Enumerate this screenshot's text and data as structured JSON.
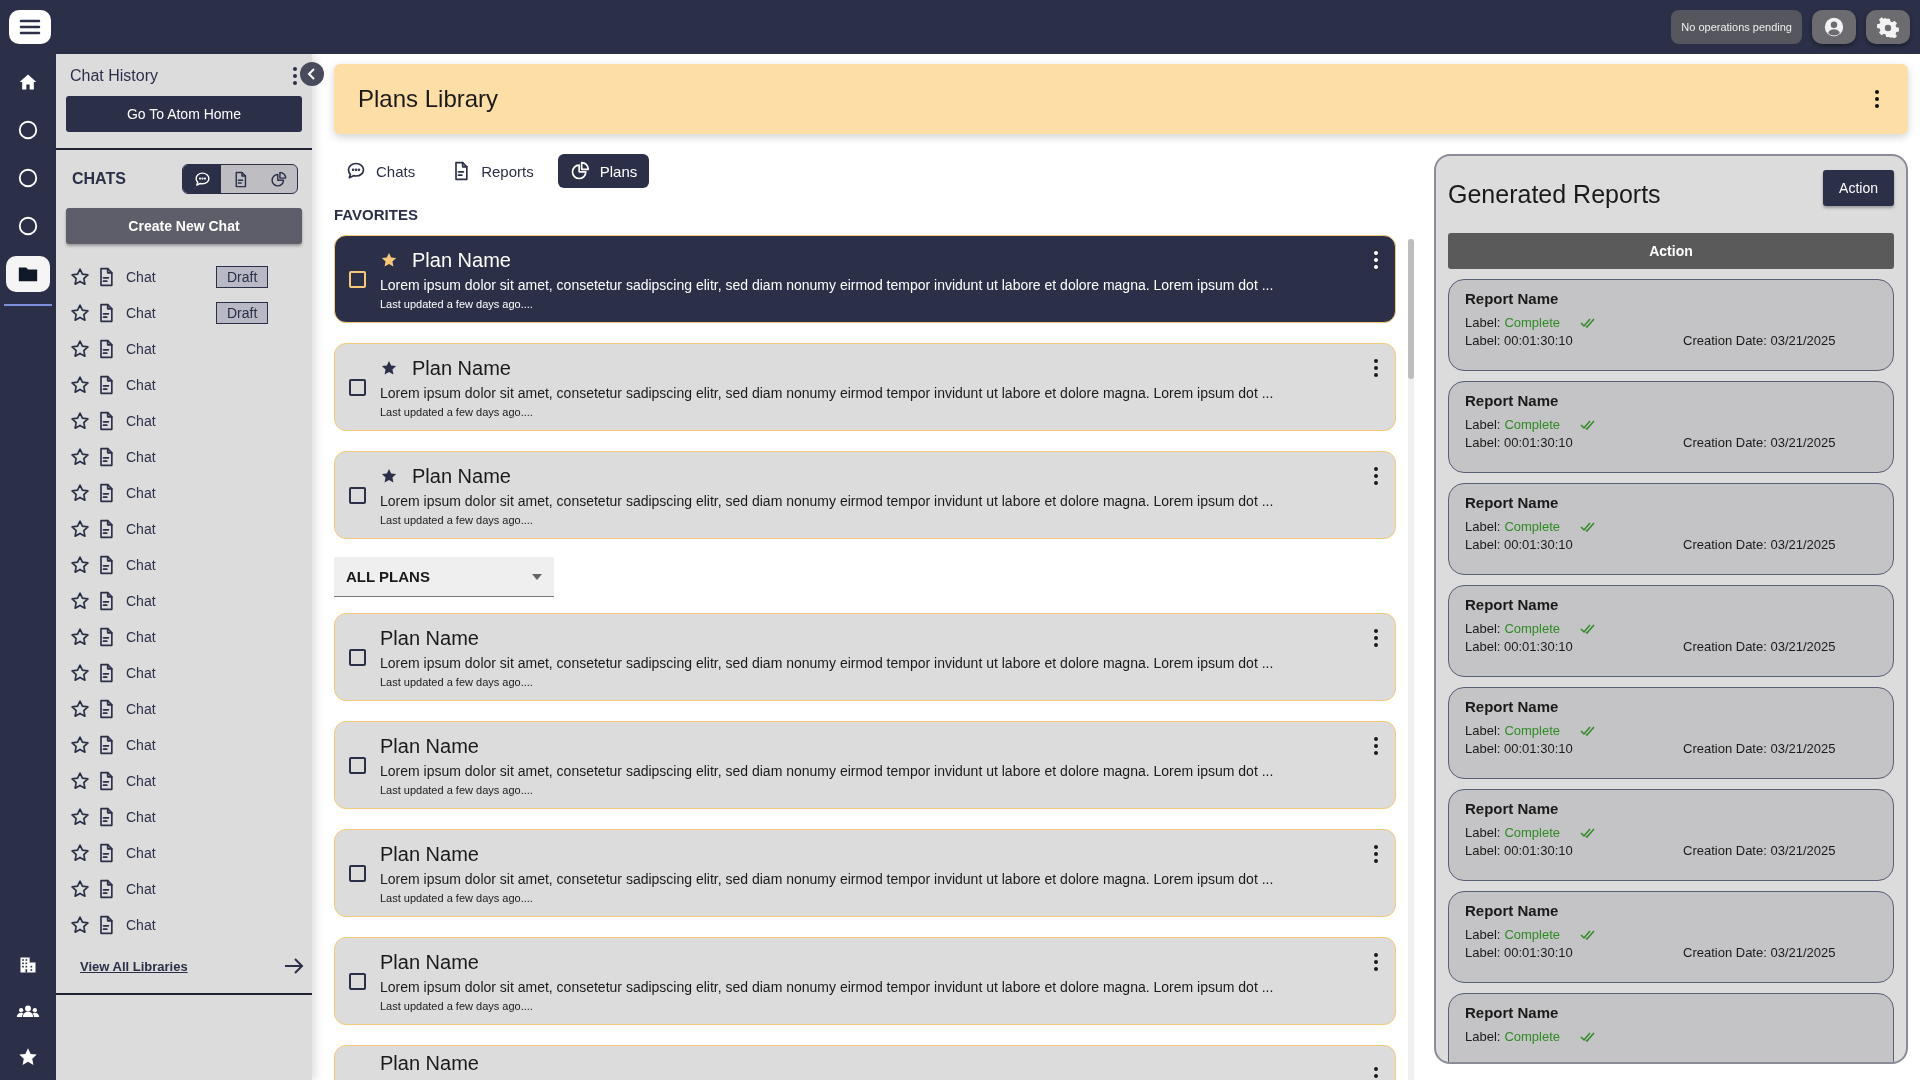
{
  "topbar": {
    "status": "No operations pending"
  },
  "rail": {
    "top": [
      {
        "kind": "home",
        "selected": false
      },
      {
        "kind": "circle",
        "selected": false
      },
      {
        "kind": "circle",
        "selected": false
      },
      {
        "kind": "circle",
        "selected": false
      },
      {
        "kind": "folder",
        "selected": true
      }
    ],
    "bottom": [
      {
        "kind": "building",
        "selected": false
      },
      {
        "kind": "people",
        "selected": false
      },
      {
        "kind": "star",
        "selected": false
      }
    ]
  },
  "sidebar": {
    "title": "Chat History",
    "home_button": "Go To Atom Home",
    "section": "CHATS",
    "toggle": [
      {
        "kind": "chat",
        "selected": true
      },
      {
        "kind": "report",
        "selected": false
      },
      {
        "kind": "plan",
        "selected": false
      }
    ],
    "create_button": "Create New Chat",
    "chats": [
      {
        "label": "Chat",
        "favorite": false,
        "badge": "Draft"
      },
      {
        "label": "Chat",
        "favorite": false,
        "badge": "Draft"
      },
      {
        "label": "Chat",
        "favorite": false
      },
      {
        "label": "Chat",
        "favorite": false
      },
      {
        "label": "Chat",
        "favorite": false
      },
      {
        "label": "Chat",
        "favorite": false
      },
      {
        "label": "Chat",
        "favorite": false
      },
      {
        "label": "Chat",
        "favorite": false
      },
      {
        "label": "Chat",
        "favorite": false
      },
      {
        "label": "Chat",
        "favorite": false
      },
      {
        "label": "Chat",
        "favorite": false
      },
      {
        "label": "Chat",
        "favorite": false
      },
      {
        "label": "Chat",
        "favorite": false
      },
      {
        "label": "Chat",
        "favorite": false
      },
      {
        "label": "Chat",
        "favorite": false
      },
      {
        "label": "Chat",
        "favorite": false
      },
      {
        "label": "Chat",
        "favorite": false
      },
      {
        "label": "Chat",
        "favorite": false
      },
      {
        "label": "Chat",
        "favorite": false
      }
    ],
    "footer_link": "View All Libraries"
  },
  "header": {
    "title": "Plans Library"
  },
  "tabs": [
    {
      "label": "Chats",
      "kind": "chat",
      "selected": false
    },
    {
      "label": "Reports",
      "kind": "report",
      "selected": false
    },
    {
      "label": "Plans",
      "kind": "plan",
      "selected": true
    }
  ],
  "favorites": {
    "heading": "FAVORITES",
    "plans": [
      {
        "name": "Plan Name",
        "favorite": true,
        "checked": false,
        "selected": true,
        "description": "Lorem ipsum dolor sit amet, consetetur sadipscing elitr, sed diam nonumy eirmod tempor invidunt ut labore et dolore magna. Lorem ipsum dot ...",
        "updated": "Last updated a few days ago...."
      },
      {
        "name": "Plan Name",
        "favorite": true,
        "checked": false,
        "selected": false,
        "description": "Lorem ipsum dolor sit amet, consetetur sadipscing elitr, sed diam nonumy eirmod tempor invidunt ut labore et dolore magna. Lorem ipsum dot ...",
        "updated": "Last updated a few days ago...."
      },
      {
        "name": "Plan Name",
        "favorite": true,
        "checked": false,
        "selected": false,
        "description": "Lorem ipsum dolor sit amet, consetetur sadipscing elitr, sed diam nonumy eirmod tempor invidunt ut labore et dolore magna. Lorem ipsum dot ...",
        "updated": "Last updated a few days ago...."
      }
    ]
  },
  "all_plans": {
    "dropdown": "ALL PLANS",
    "plans": [
      {
        "name": "Plan Name",
        "favorite": false,
        "checked": false,
        "selected": false,
        "description": "Lorem ipsum dolor sit amet, consetetur sadipscing elitr, sed diam nonumy eirmod tempor invidunt ut labore et dolore magna. Lorem ipsum dot ...",
        "updated": "Last updated a few days ago...."
      },
      {
        "name": "Plan Name",
        "favorite": false,
        "checked": false,
        "selected": false,
        "description": "Lorem ipsum dolor sit amet, consetetur sadipscing elitr, sed diam nonumy eirmod tempor invidunt ut labore et dolore magna. Lorem ipsum dot ...",
        "updated": "Last updated a few days ago...."
      },
      {
        "name": "Plan Name",
        "favorite": false,
        "checked": false,
        "selected": false,
        "description": "Lorem ipsum dolor sit amet, consetetur sadipscing elitr, sed diam nonumy eirmod tempor invidunt ut labore et dolore magna. Lorem ipsum dot ...",
        "updated": "Last updated a few days ago...."
      },
      {
        "name": "Plan Name",
        "favorite": false,
        "checked": false,
        "selected": false,
        "description": "Lorem ipsum dolor sit amet, consetetur sadipscing elitr, sed diam nonumy eirmod tempor invidunt ut labore et dolore magna. Lorem ipsum dot ...",
        "updated": "Last updated a few days ago...."
      },
      {
        "name": "Plan Name",
        "favorite": false,
        "selected": false
      }
    ]
  },
  "reports": {
    "title": "Generated Reports",
    "action": "Action",
    "bar_action": "Action",
    "items": [
      {
        "name": "Report Name",
        "status_label": "Label:",
        "status": "Complete",
        "time": "Label: 00:01:30:10",
        "date": "Creation Date: 03/21/2025"
      },
      {
        "name": "Report Name",
        "status_label": "Label:",
        "status": "Complete",
        "time": "Label: 00:01:30:10",
        "date": "Creation Date: 03/21/2025"
      },
      {
        "name": "Report Name",
        "status_label": "Label:",
        "status": "Complete",
        "time": "Label: 00:01:30:10",
        "date": "Creation Date: 03/21/2025"
      },
      {
        "name": "Report Name",
        "status_label": "Label:",
        "status": "Complete",
        "time": "Label: 00:01:30:10",
        "date": "Creation Date: 03/21/2025"
      },
      {
        "name": "Report Name",
        "status_label": "Label:",
        "status": "Complete",
        "time": "Label: 00:01:30:10",
        "date": "Creation Date: 03/21/2025"
      },
      {
        "name": "Report Name",
        "status_label": "Label:",
        "status": "Complete",
        "time": "Label: 00:01:30:10",
        "date": "Creation Date: 03/21/2025"
      },
      {
        "name": "Report Name",
        "status_label": "Label:",
        "status": "Complete",
        "time": "Label: 00:01:30:10",
        "date": "Creation Date: 03/21/2025"
      },
      {
        "name": "Report Name",
        "status_label": "Label:",
        "status": "Complete"
      }
    ]
  }
}
